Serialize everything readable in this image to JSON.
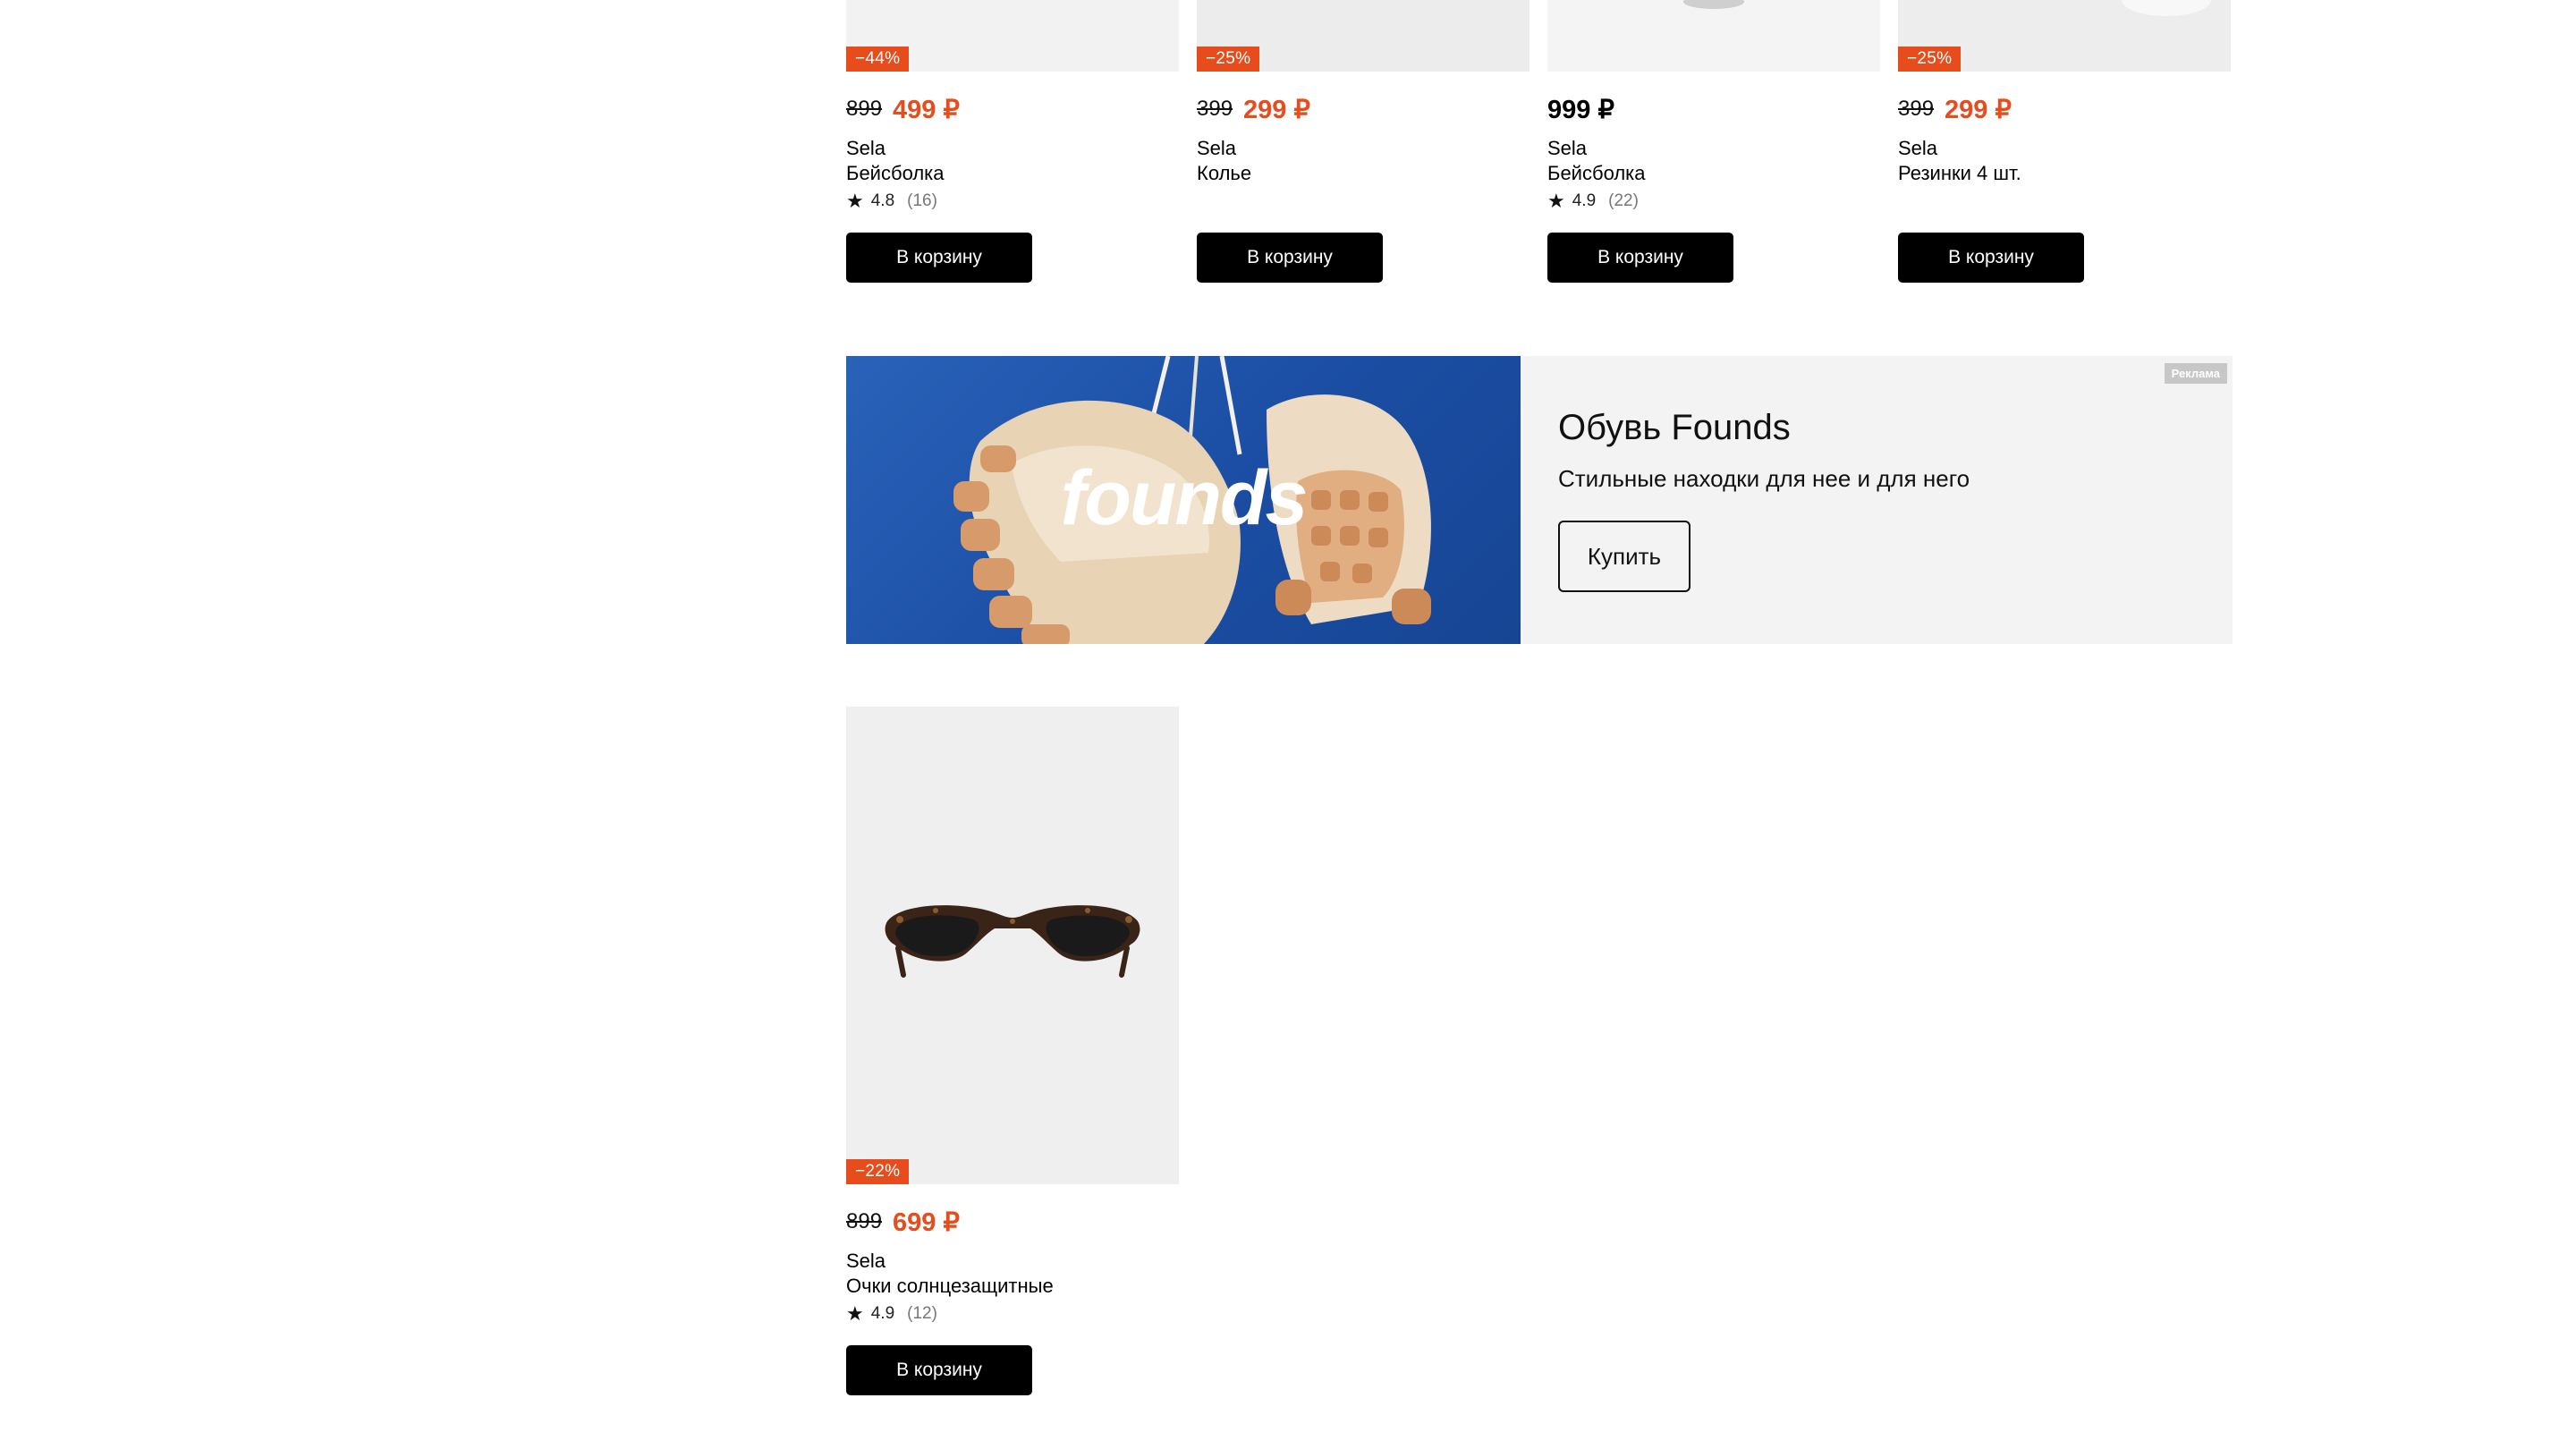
{
  "products_row": [
    {
      "discount": "−44%",
      "old_price": "899",
      "price": "499 ₽",
      "brand": "Sela",
      "title": "Бейсболка",
      "rating": "4.8",
      "reviews": "(16)",
      "cart_label": "В корзину"
    },
    {
      "discount": "−25%",
      "old_price": "399",
      "price": "299 ₽",
      "brand": "Sela",
      "title": "Колье",
      "cart_label": "В корзину"
    },
    {
      "price": "999 ₽",
      "brand": "Sela",
      "title": "Бейсболка",
      "rating": "4.9",
      "reviews": "(22)",
      "cart_label": "В корзину"
    },
    {
      "discount": "−25%",
      "old_price": "399",
      "price": "299 ₽",
      "brand": "Sela",
      "title": "Резинки 4 шт.",
      "cart_label": "В корзину"
    }
  ],
  "banner": {
    "logo_text": "founds",
    "ad_label": "Реклама",
    "title": "Обувь Founds",
    "subtitle": "Стильные находки для нее и для него",
    "button_label": "Купить"
  },
  "product_big": {
    "discount": "−22%",
    "old_price": "899",
    "price": "699 ₽",
    "brand": "Sela",
    "title": "Очки солнцезащитные",
    "rating": "4.9",
    "reviews": "(12)",
    "cart_label": "В корзину"
  },
  "colors": {
    "accent": "#e74c1c",
    "button": "#000000",
    "banner_blue": "#1f56ad"
  }
}
